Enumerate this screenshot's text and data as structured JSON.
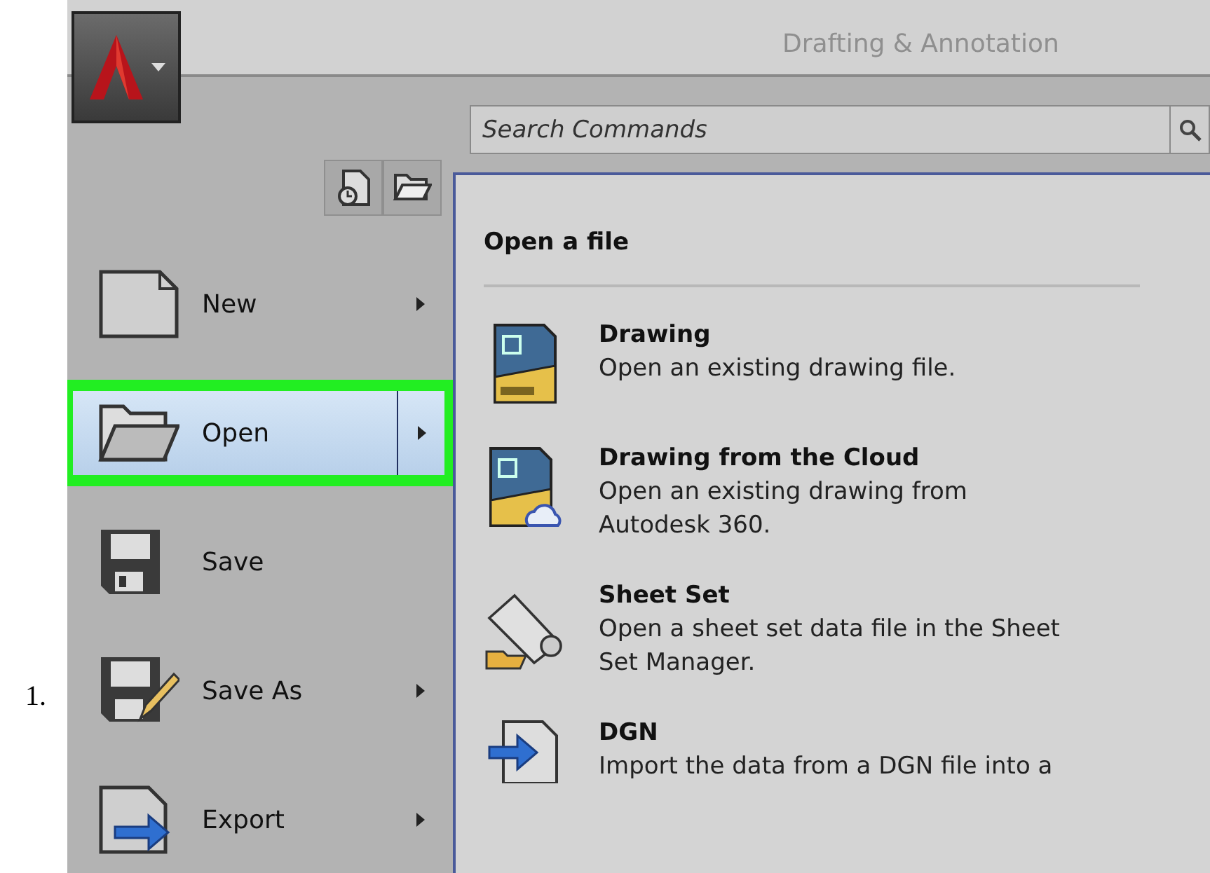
{
  "list_marker": "1.",
  "title_bar": {
    "title": "Drafting & Annotation"
  },
  "search": {
    "placeholder": "Search Commands"
  },
  "menu_items": [
    {
      "label": "New",
      "kind": "new",
      "selected": false,
      "highlighted": false,
      "has_submenu": true
    },
    {
      "label": "Open",
      "kind": "open",
      "selected": true,
      "highlighted": true,
      "has_submenu": true
    },
    {
      "label": "Save",
      "kind": "save",
      "selected": false,
      "highlighted": false,
      "has_submenu": false
    },
    {
      "label": "Save As",
      "kind": "saveas",
      "selected": false,
      "highlighted": false,
      "has_submenu": true
    },
    {
      "label": "Export",
      "kind": "export",
      "selected": false,
      "highlighted": false,
      "has_submenu": true
    }
  ],
  "submenu": {
    "heading": "Open a file",
    "items": [
      {
        "kind": "dwg",
        "title": "Drawing",
        "description": "Open an existing drawing file."
      },
      {
        "kind": "cloud",
        "title": "Drawing from the Cloud",
        "description": "Open an existing drawing from Autodesk 360."
      },
      {
        "kind": "sheetset",
        "title": "Sheet Set",
        "description": "Open a sheet set data file in the Sheet Set Manager."
      },
      {
        "kind": "dgn",
        "title": "DGN",
        "description": "Import the data from a DGN file into a"
      }
    ]
  }
}
